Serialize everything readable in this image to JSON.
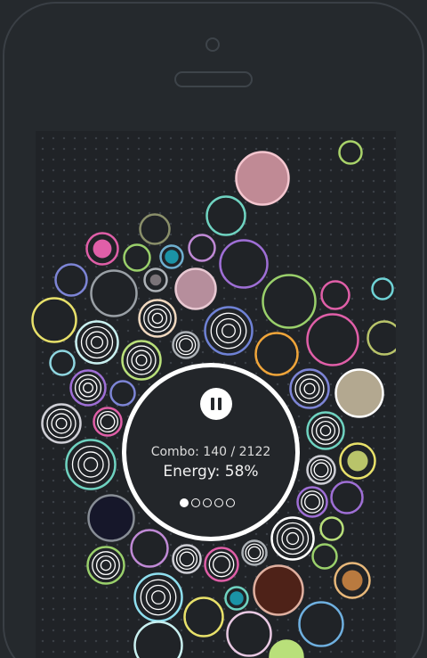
{
  "hud": {
    "combo_label": "Combo: 140 / 2122",
    "energy_label": "Energy: 58%",
    "pause_icon": "pause-icon",
    "pages_total": 5,
    "page_active": 1
  },
  "colors": {
    "background": "#25292d",
    "screen": "#202327",
    "ring": "#ffffff"
  }
}
